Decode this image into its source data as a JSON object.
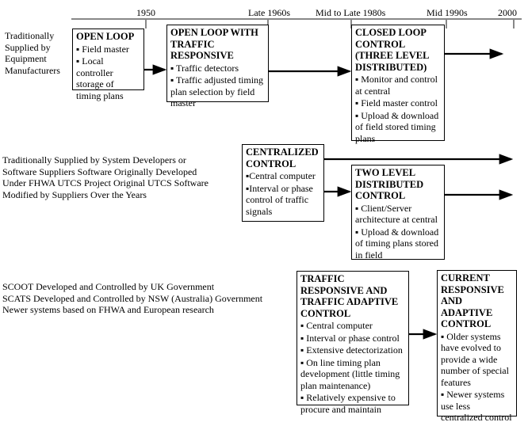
{
  "timeline": [
    "1950",
    "Late 1960s",
    "Mid to Late 1980s",
    "Mid 1990s",
    "2000"
  ],
  "groups": [
    "Traditionally Supplied by Equipment Manufacturers",
    "Traditionally Supplied by System Developers or Software Suppliers Software Originally Developed Under FHWA UTCS Project Original UTCS Software Modified by Suppliers Over the Years",
    "SCOOT Developed and Controlled by UK Government SCATS Developed and Controlled by NSW (Australia) Government Newer systems based on FHWA and European research"
  ],
  "group_lines": {
    "g1": [
      "Traditionally",
      "Supplied by",
      "Equipment",
      "Manufacturers"
    ],
    "g2": [
      "Traditionally Supplied by System Developers or",
      "Software Suppliers Software Originally Developed",
      "Under FHWA UTCS Project Original UTCS Software",
      "Modified by Suppliers Over the Years"
    ],
    "g3": [
      "SCOOT Developed and Controlled by UK Government",
      "SCATS Developed and Controlled by NSW (Australia) Government",
      "Newer systems based on FHWA and European research"
    ]
  },
  "boxes": {
    "open_loop": {
      "title": "OPEN LOOP",
      "items": [
        "▪ Field master",
        "▪ Local controller storage of timing plans"
      ]
    },
    "open_loop_traffic": {
      "title": "OPEN LOOP WITH TRAFFIC RESPONSIVE",
      "items": [
        "▪ Traffic detectors",
        "▪ Traffic adjusted timing plan selection by field master"
      ]
    },
    "closed_loop": {
      "title": "CLOSED LOOP CONTROL (THREE LEVEL DISTRIBUTED)",
      "items": [
        "▪ Monitor and control at central",
        "▪ Field master control",
        "▪ Upload & download of field stored timing plans"
      ]
    },
    "centralized": {
      "title": "CENTRALIZED CONTROL",
      "items": [
        "▪Central computer",
        "▪Interval or phase control of traffic signals"
      ]
    },
    "two_level": {
      "title": "TWO LEVEL DISTRIBUTED CONTROL",
      "items": [
        "▪ Client/Server architecture at central",
        "▪ Upload & download of timing plans stored in field"
      ]
    },
    "traffic_adaptive": {
      "title": "TRAFFIC RESPONSIVE AND TRAFFIC ADAPTIVE CONTROL",
      "items": [
        "▪ Central computer",
        "▪ Interval or phase control",
        "▪ Extensive detectorization",
        "▪ On line timing plan development (little timing plan maintenance)",
        "▪ Relatively expensive to procure and maintain"
      ]
    },
    "current": {
      "title": "CURRENT RESPONSIVE AND ADAPTIVE CONTROL",
      "items": [
        "▪ Older systems have evolved to provide a wide number of special features",
        "▪ Newer systems use less centralized control"
      ]
    }
  }
}
